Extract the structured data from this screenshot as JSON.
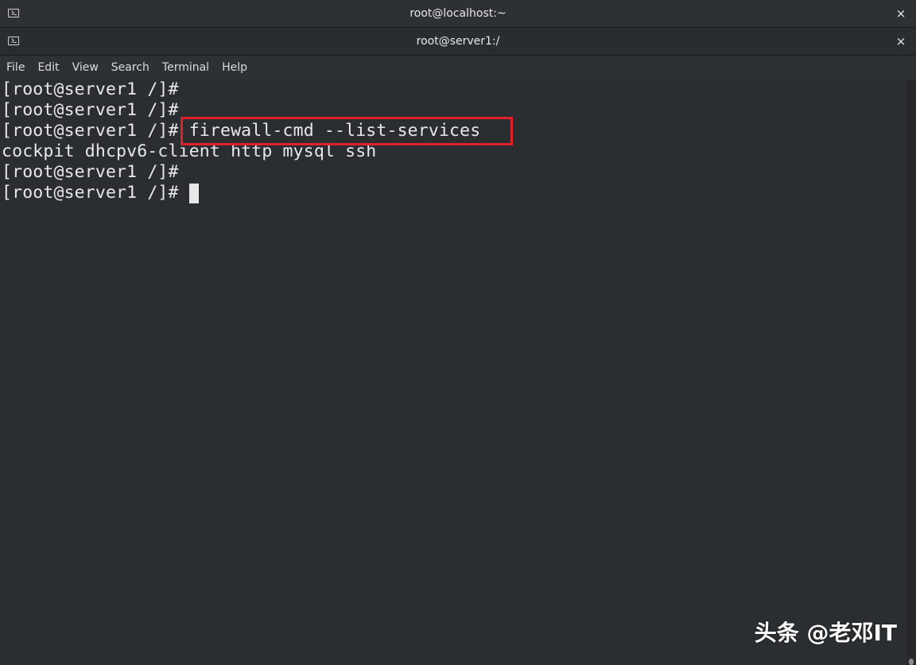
{
  "windows": {
    "outer_title": "root@localhost:~",
    "inner_title": "root@server1:/",
    "close_glyph": "×"
  },
  "menu": {
    "items": [
      {
        "label": "File"
      },
      {
        "label": "Edit"
      },
      {
        "label": "View"
      },
      {
        "label": "Search"
      },
      {
        "label": "Terminal"
      },
      {
        "label": "Help"
      }
    ]
  },
  "terminal": {
    "lines": [
      "[root@server1 /]#",
      "[root@server1 /]#",
      "[root@server1 /]# firewall-cmd --list-services",
      "cockpit dhcpv6-client http mysql ssh",
      "[root@server1 /]#",
      "[root@server1 /]#"
    ],
    "highlighted_command": "firewall-cmd --list-services",
    "highlight_color": "#e0202a"
  },
  "watermark": {
    "text": "头条 @老邓IT"
  },
  "colors": {
    "background": "#2b2e30",
    "text": "#e8e8e8",
    "titlebar": "#2d3133"
  },
  "icons": {
    "window_icon": "terminal-icon",
    "close_icon": "close-icon"
  }
}
